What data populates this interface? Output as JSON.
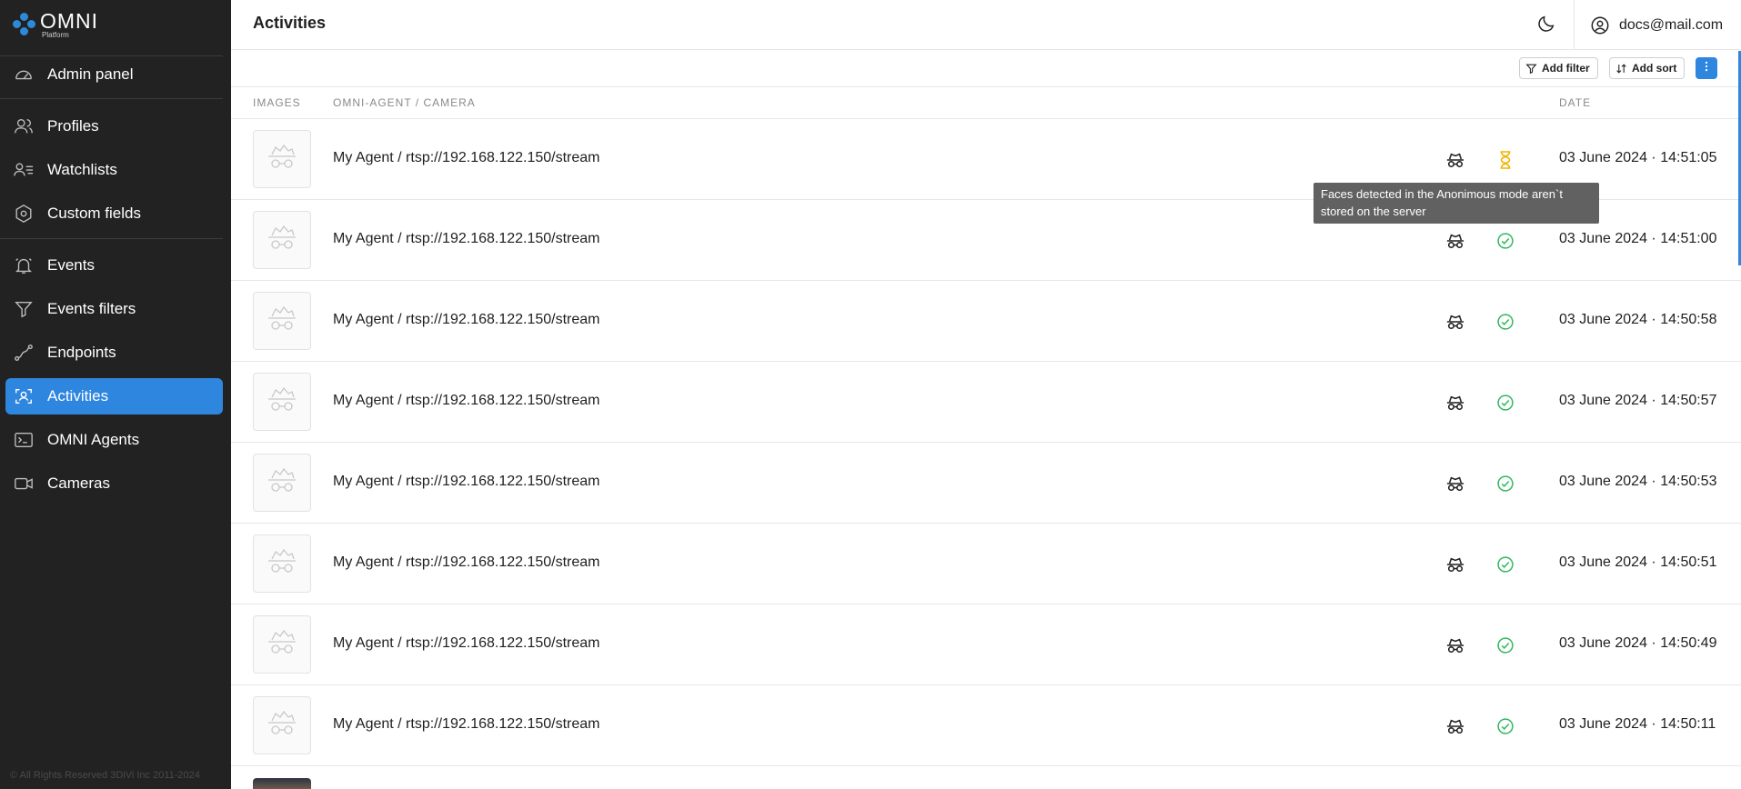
{
  "brand": {
    "name": "OMNI",
    "subtitle": "Platform",
    "accent": "#2e86de"
  },
  "sidebar": {
    "items": [
      {
        "label": "Admin panel",
        "icon": "gauge-icon"
      },
      {
        "label": "Profiles",
        "icon": "users-icon"
      },
      {
        "label": "Watchlists",
        "icon": "user-list-icon"
      },
      {
        "label": "Custom fields",
        "icon": "hexagon-gear-icon"
      },
      {
        "label": "Events",
        "icon": "bell-icon"
      },
      {
        "label": "Events filters",
        "icon": "filter-icon"
      },
      {
        "label": "Endpoints",
        "icon": "route-icon"
      },
      {
        "label": "Activities",
        "icon": "face-scan-icon",
        "active": true
      },
      {
        "label": "OMNI Agents",
        "icon": "terminal-icon"
      },
      {
        "label": "Cameras",
        "icon": "video-camera-icon"
      }
    ],
    "copyright": "© All Rights Reserved 3DiVi Inc 2011-2024"
  },
  "header": {
    "title": "Activities",
    "user_email": "docs@mail.com"
  },
  "toolbar": {
    "add_filter": "Add filter",
    "add_sort": "Add sort"
  },
  "table": {
    "columns": {
      "images": "IMAGES",
      "agent_camera": "OMNI-AGENT / CAMERA",
      "date": "DATE"
    },
    "rows": [
      {
        "source": "My Agent / rtsp://192.168.122.150/stream",
        "status": "pending",
        "date": "03 June 2024 · 14:51:05"
      },
      {
        "source": "My Agent / rtsp://192.168.122.150/stream",
        "status": "done",
        "date": "03 June 2024 · 14:51:00"
      },
      {
        "source": "My Agent / rtsp://192.168.122.150/stream",
        "status": "done",
        "date": "03 June 2024 · 14:50:58"
      },
      {
        "source": "My Agent / rtsp://192.168.122.150/stream",
        "status": "done",
        "date": "03 June 2024 · 14:50:57"
      },
      {
        "source": "My Agent / rtsp://192.168.122.150/stream",
        "status": "done",
        "date": "03 June 2024 · 14:50:53"
      },
      {
        "source": "My Agent / rtsp://192.168.122.150/stream",
        "status": "done",
        "date": "03 June 2024 · 14:50:51"
      },
      {
        "source": "My Agent / rtsp://192.168.122.150/stream",
        "status": "done",
        "date": "03 June 2024 · 14:50:49"
      },
      {
        "source": "My Agent / rtsp://192.168.122.150/stream",
        "status": "done",
        "date": "03 June 2024 · 14:50:11"
      }
    ]
  },
  "tooltip": {
    "text": "Faces detected in the Anonimous mode aren`t stored on the server"
  },
  "colors": {
    "success": "#2eb85c",
    "pending": "#f0b400",
    "sidebar_bg": "#222222"
  }
}
